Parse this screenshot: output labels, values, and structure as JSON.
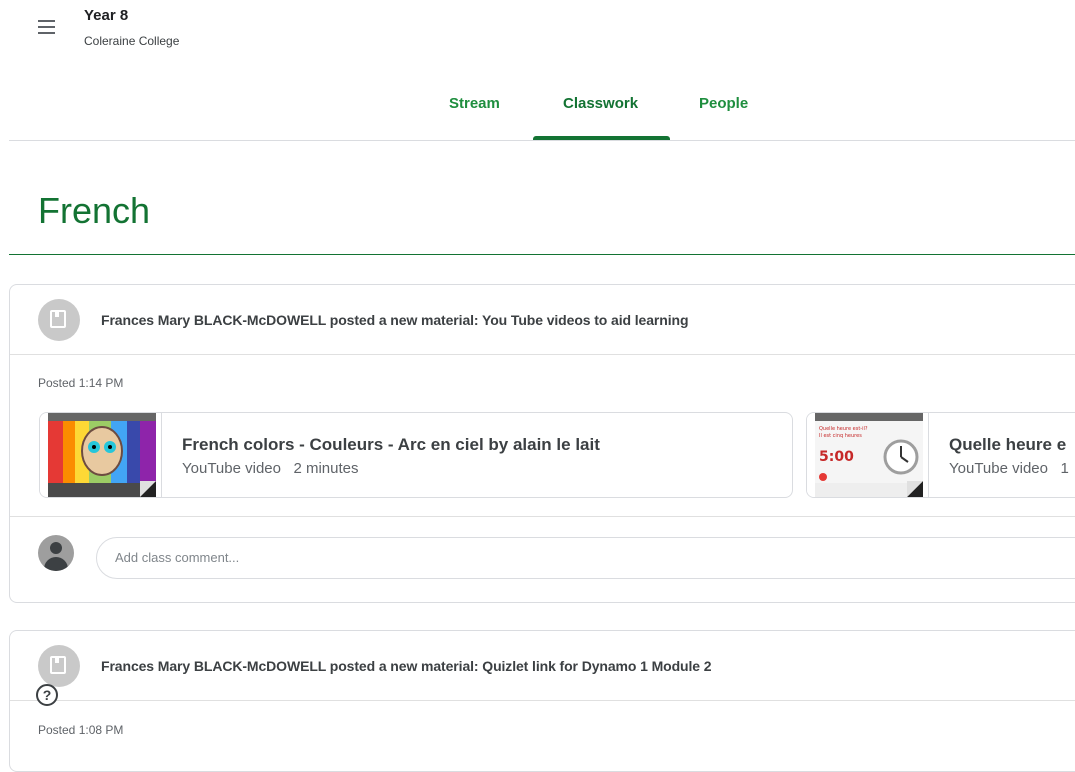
{
  "header": {
    "class_name": "Year 8",
    "school": "Coleraine College"
  },
  "tabs": [
    {
      "label": "Stream"
    },
    {
      "label": "Classwork",
      "active": true
    },
    {
      "label": "People"
    }
  ],
  "section": {
    "title": "French"
  },
  "posts": [
    {
      "author_text": "Frances Mary BLACK-McDOWELL posted a new material: You Tube videos to aid learning",
      "posted": "Posted 1:14 PM",
      "attachments": [
        {
          "title": "French colors - Couleurs - Arc en ciel by alain le lait",
          "subtitle": "YouTube video   2 minutes"
        },
        {
          "title": "Quelle heure e",
          "subtitle": "YouTube video   1"
        }
      ],
      "comment_placeholder": "Add class comment..."
    },
    {
      "author_text": "Frances Mary BLACK-McDOWELL posted a new material: Quizlet link for Dynamo 1 Module 2",
      "posted": "Posted 1:08 PM"
    }
  ],
  "help_symbol": "?",
  "thumbnail2": {
    "line1": "Quelle heure est-il?",
    "line2": "Il est cinq heures",
    "time": "5:00"
  },
  "colors": {
    "accent": "#137333",
    "tab_text": "#1e8e3e",
    "divider": "#dadce0"
  },
  "icons": [
    "menu-icon",
    "material-icon",
    "user-avatar-icon",
    "help-icon"
  ]
}
